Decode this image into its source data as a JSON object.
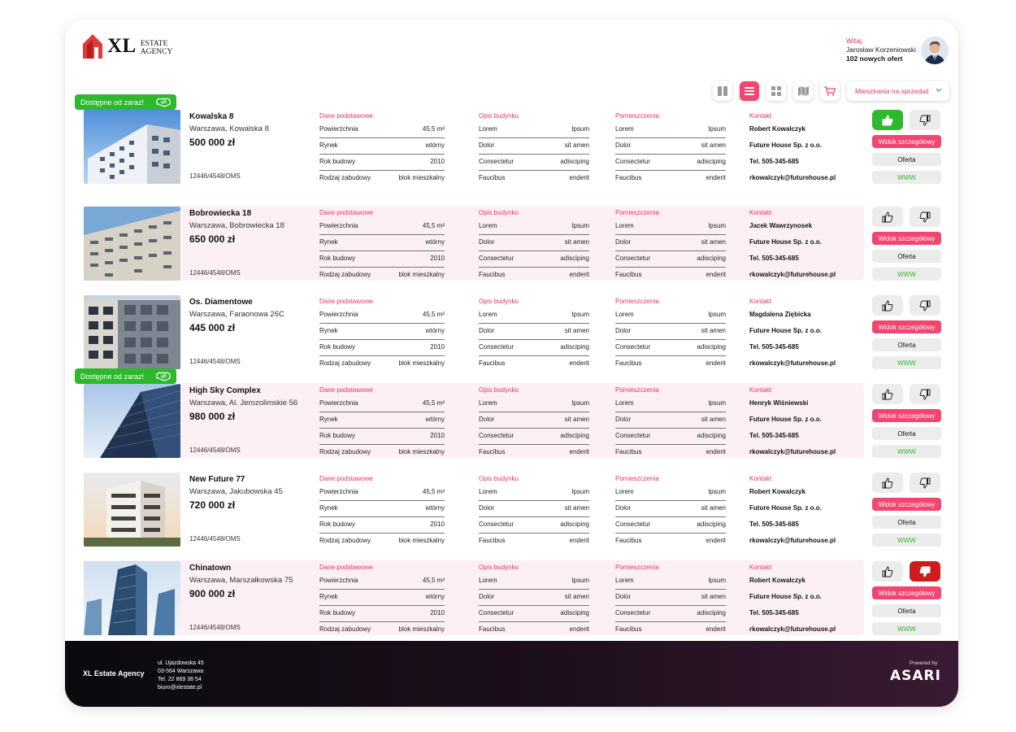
{
  "header": {
    "logo_text": "XL",
    "logo_sub_1": "ESTATE",
    "logo_sub_2": "AGENCY",
    "greeting": "Witaj,",
    "user_name": "Jarosław Korzeniowski",
    "offers": "102 nowych ofert"
  },
  "toolbar": {
    "icons": [
      "columns-view-icon",
      "list-view-icon",
      "grid-view-icon",
      "map-view-icon",
      "cart-icon"
    ],
    "active": "list-view-icon",
    "dropdown_value": "Mieszkania na sprzedaż"
  },
  "labels": {
    "section_basic": "Dane podstawowe",
    "section_building": "Opis budynku",
    "section_rooms": "Pomieszczenia",
    "section_contact": "Kontakt",
    "area": "Powierzchnia",
    "market": "Rynek",
    "year": "Rok budowy",
    "type": "Rodzaj zabudowy",
    "lorem": "Lorem",
    "dolor": "Dolor",
    "consectetur": "Consectetur",
    "faucibus": "Faucibus",
    "ipsum": "Ipsum",
    "sitamet": "sit amen",
    "adiscipling": "adisciping",
    "enderit": "enderit",
    "detail_btn": "Widok szczegółowy",
    "offer_btn": "Oferta",
    "www_btn": "WWW",
    "badge": "Dostępne od zaraz!"
  },
  "listings": [
    {
      "title": "Kowalska 8",
      "address": "Warszawa, Kowalska 8",
      "price": "500 000 zł",
      "ref": "12446/4548/OMS",
      "area": "45,5 m²",
      "market": "wtórny",
      "year": "2010",
      "type": "blok mieszkalny",
      "contact": "Robert Kowalczyk",
      "company": "Future House Sp. z o.o.",
      "phone": "Tel. 505-345-685",
      "email": "rkowalczyk@futurehouse.pl",
      "badge": true,
      "vote": "up",
      "bg": "white"
    },
    {
      "title": "Bobrowiecka 18",
      "address": "Warszawa, Bobrowiecka 18",
      "price": "650 000 zł",
      "ref": "12446/4548/OMS",
      "area": "45,5 m²",
      "market": "wtórny",
      "year": "2010",
      "type": "blok mieszkalny",
      "contact": "Jacek Wawrzynosek",
      "company": "Future House Sp. z o.o.",
      "phone": "Tel. 505-345-685",
      "email": "rkowalczyk@futurehouse.pl",
      "badge": false,
      "vote": "none",
      "bg": "pink"
    },
    {
      "title": "Os. Diamentowe",
      "address": "Warszawa, Faraonowa 26C",
      "price": "445 000 zł",
      "ref": "12446/4548/OMS",
      "area": "45,5 m²",
      "market": "wtórny",
      "year": "2010",
      "type": "blok mieszkalny",
      "contact": "Magdalena Ziębicka",
      "company": "Future House Sp. z o.o.",
      "phone": "Tel. 505-345-685",
      "email": "rkowalczyk@futurehouse.pl",
      "badge": false,
      "vote": "none",
      "bg": "white"
    },
    {
      "title": "High Sky Complex",
      "address": "Warszawa, Al. Jerozolimskie 56",
      "price": "980 000 zł",
      "ref": "12446/4548/OMS",
      "area": "45,5 m²",
      "market": "wtórny",
      "year": "2010",
      "type": "blok mieszkalny",
      "contact": "Henryk Wiśniewski",
      "company": "Future House Sp. z o.o.",
      "phone": "Tel. 505-345-685",
      "email": "rkowalczyk@futurehouse.pl",
      "badge": true,
      "vote": "none",
      "bg": "pink"
    },
    {
      "title": "New Future 77",
      "address": "Warszawa, Jakubowska 45",
      "price": "720 000 zł",
      "ref": "12446/4548/OMS",
      "area": "45,5 m²",
      "market": "wtórny",
      "year": "2010",
      "type": "blok mieszkalny",
      "contact": "Robert Kowalczyk",
      "company": "Future House Sp. z o.o.",
      "phone": "Tel. 505-345-685",
      "email": "rkowalczyk@futurehouse.pl",
      "badge": false,
      "vote": "none",
      "bg": "white"
    },
    {
      "title": "Chinatown",
      "address": "Warszawa, Marszałkowska 75",
      "price": "900 000 zł",
      "ref": "12446/4548/OMS",
      "area": "45,5 m²",
      "market": "wtórny",
      "year": "2010",
      "type": "blok mieszkalny",
      "contact": "Robert Kowalczyk",
      "company": "Future House Sp. z o.o.",
      "phone": "Tel. 505-345-685",
      "email": "rkowalczyk@futurehouse.pl",
      "badge": false,
      "vote": "down",
      "bg": "pink"
    }
  ],
  "footer": {
    "company": "XL Estate Agency",
    "address_lines": [
      "ul. Ujazdowska 45",
      "03-564 Warszawa",
      "Tel. 22 869 38 54",
      "biuro@xlestate.pl"
    ],
    "powered_by": "Powered by",
    "brand": "ASARI"
  },
  "colors": {
    "accent": "#f2456f",
    "green": "#2eb82e",
    "red": "#cc1c1c",
    "pink_row": "#fdf0f4"
  }
}
